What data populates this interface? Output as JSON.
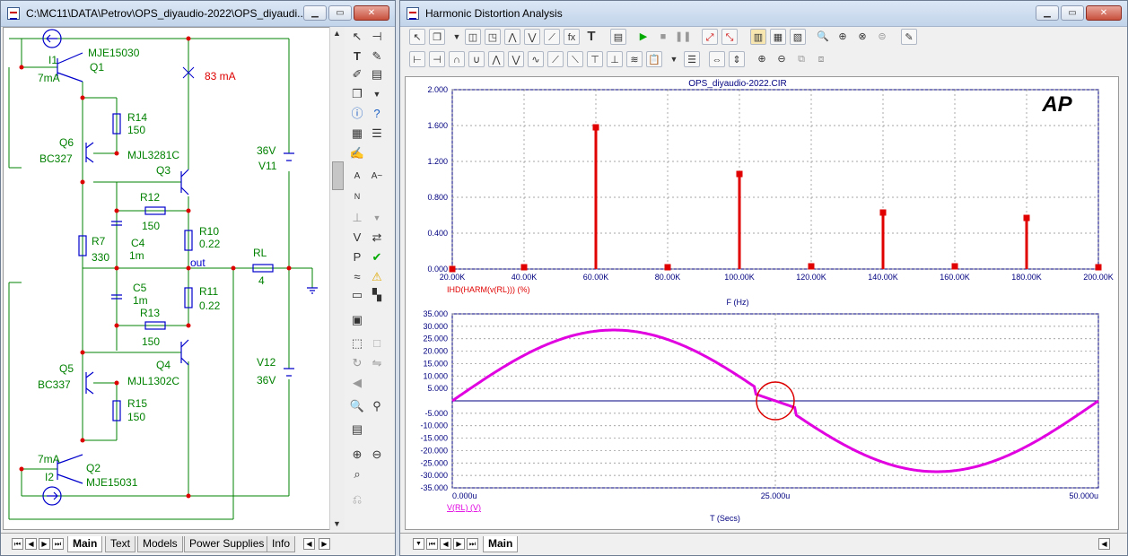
{
  "left_window": {
    "title": "C:\\MC11\\DATA\\Petrov\\OPS_diyaudio-2022\\OPS_diyaudi...",
    "tabs": [
      "Main",
      "Text",
      "Models",
      "Power Supplies",
      "Info"
    ],
    "active_tab": "Main",
    "schematic": {
      "labels": {
        "I1": "I1",
        "I1_val": "7mA",
        "Q1": "Q1",
        "Q1_model": "MJE15030",
        "current": "83 mA",
        "R14": "R14",
        "R14_val": "150",
        "Q6": "Q6",
        "Q6_model": "BC327",
        "Q3_model": "MJL3281C",
        "Q3": "Q3",
        "V11_val": "36V",
        "V11": "V11",
        "R12": "R12",
        "R12_val": "150",
        "R10": "R10",
        "R10_val": "0.22",
        "R7": "R7",
        "R7_val": "330",
        "C4": "C4",
        "C4_val": "1m",
        "RL": "RL",
        "RL_val": "4",
        "out": "out",
        "C5": "C5",
        "C5_val": "1m",
        "R11": "R11",
        "R11_val": "0.22",
        "R13": "R13",
        "R13_val": "150",
        "Q4": "Q4",
        "V12": "V12",
        "V12_val": "36V",
        "Q5": "Q5",
        "Q5_model": "BC337",
        "Q4_model": "MJL1302C",
        "R15": "R15",
        "R15_val": "150",
        "I2_val": "7mA",
        "Q2": "Q2",
        "I2": "I2",
        "Q2_model": "MJE15031"
      }
    }
  },
  "right_window": {
    "title": "Harmonic Distortion Analysis",
    "tabs": [
      "Main"
    ],
    "active_tab": "Main"
  },
  "colors": {
    "wire": "#008000",
    "component": "#0000cc",
    "current": "#dd0000",
    "harmonic": "#e00000",
    "waveform": "#e000e0"
  },
  "chart_data": [
    {
      "type": "bar",
      "title": "OPS_diyaudio-2022.CIR",
      "annotation": "AP",
      "xlabel": "F (Hz)",
      "ylabel": "",
      "series": [
        {
          "name": "IHD(HARM(v(RL))) (%)",
          "values": [
            0.0,
            0.02,
            1.58,
            0.02,
            1.06,
            0.03,
            0.63,
            0.03,
            0.57,
            0.02
          ]
        }
      ],
      "x": [
        20000,
        40000,
        60000,
        80000,
        100000,
        120000,
        140000,
        160000,
        180000,
        200000
      ],
      "xlim": [
        20000,
        200000
      ],
      "ylim": [
        0,
        2.0
      ],
      "x_ticks": [
        "20.00K",
        "40.00K",
        "60.00K",
        "80.00K",
        "100.00K",
        "120.00K",
        "140.00K",
        "160.00K",
        "180.00K",
        "200.00K"
      ],
      "y_ticks": [
        "0.000",
        "0.400",
        "0.800",
        "1.200",
        "1.600",
        "2.000"
      ],
      "grid": true
    },
    {
      "type": "line",
      "xlabel": "T (Secs)",
      "ylabel": "",
      "series": [
        {
          "name": "V(RL) (V)",
          "amplitude": 28.5,
          "period_us": 50,
          "crossover_notch_at_us": 25
        }
      ],
      "xlim": [
        0,
        50
      ],
      "ylim": [
        -35,
        35
      ],
      "x_ticks": [
        "0.000u",
        "25.000u",
        "50.000u"
      ],
      "y_ticks": [
        "35.000",
        "30.000",
        "25.000",
        "20.000",
        "15.000",
        "10.000",
        "5.000",
        "-5.000",
        "-10.000",
        "-15.000",
        "-20.000",
        "-25.000",
        "-30.000",
        "-35.000"
      ],
      "grid": true,
      "highlight": "crossover distortion at 25.000u"
    }
  ]
}
